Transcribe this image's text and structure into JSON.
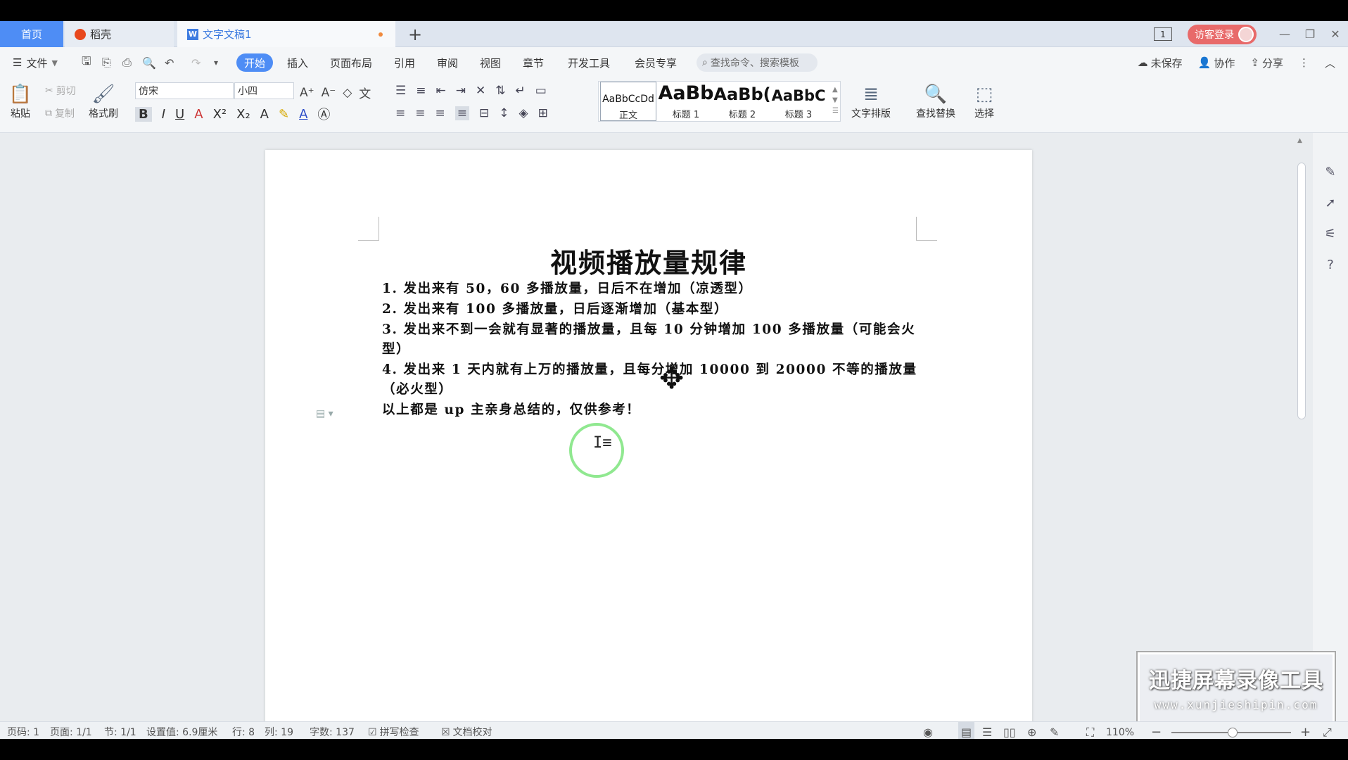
{
  "tabs": {
    "home": "首页",
    "daoke": "稻壳",
    "doc": "文字文稿1",
    "add": "+"
  },
  "titlebar": {
    "window_count": "1",
    "login": "访客登录"
  },
  "menu": {
    "file": "文件",
    "items": [
      "开始",
      "插入",
      "页面布局",
      "引用",
      "审阅",
      "视图",
      "章节",
      "开发工具",
      "会员专享"
    ],
    "search_placeholder": "查找命令、搜索模板",
    "unsaved": "未保存",
    "collab": "协作",
    "share": "分享"
  },
  "ribbon": {
    "paste": "粘贴",
    "cut": "剪切",
    "copy": "复制",
    "format_painter": "格式刷",
    "font": "仿宋",
    "size": "小四",
    "styles": [
      {
        "sample": "AaBbCcDd",
        "name": "正文"
      },
      {
        "sample": "AaBb",
        "name": "标题 1"
      },
      {
        "sample": "AaBb(",
        "name": "标题 2"
      },
      {
        "sample": "AaBbC",
        "name": "标题 3"
      }
    ],
    "text_layout": "文字排版",
    "find_replace": "查找替换",
    "select": "选择"
  },
  "document": {
    "title": "视频播放量规律",
    "paragraphs": [
      "1. 发出来有 50，60 多播放量，日后不在增加（凉透型）",
      "2. 发出来有 100 多播放量，日后逐渐增加（基本型）",
      "3. 发出来不到一会就有显著的播放量，且每 10 分钟增加 100 多播放量（可能会火型）",
      "4. 发出来 1 天内就有上万的播放量，且每分增加 10000 到 20000 不等的播放量（必火型）",
      "以上都是 up 主亲身总结的，仅供参考！"
    ]
  },
  "watermark": {
    "main": "迅捷屏幕录像工具",
    "sub": "www.xunjieshipin.com"
  },
  "status": {
    "page_no": "页码: 1",
    "pages": "页面: 1/1",
    "section": "节: 1/1",
    "setting": "设置值: 6.9厘米",
    "row": "行: 8",
    "col": "列: 19",
    "words": "字数: 137",
    "spell": "拼写检查",
    "proof": "文档校对",
    "zoom": "110%"
  }
}
